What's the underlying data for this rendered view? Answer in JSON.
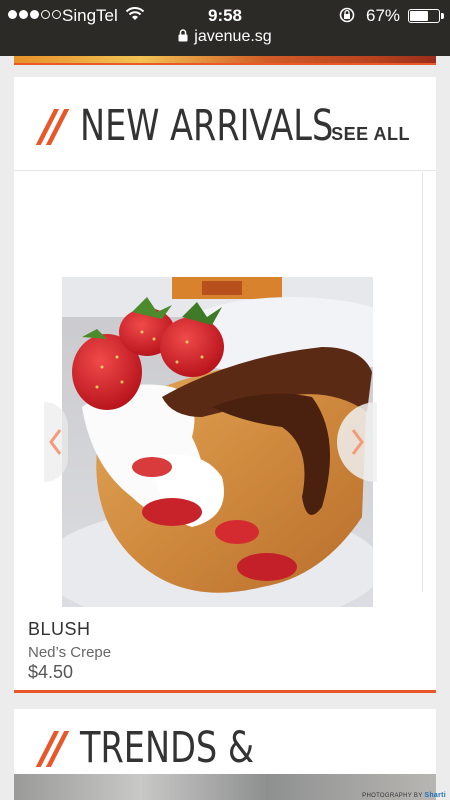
{
  "status_bar": {
    "carrier": "SingTel",
    "time": "9:58",
    "battery_percent": "67%",
    "battery_level": 0.67,
    "signal_bars": 3,
    "url": "javenue.sg"
  },
  "new_arrivals": {
    "slashes": "//",
    "title": "NEW ARRIVALS",
    "see_all": "SEE ALL",
    "product": {
      "name": "BLUSH",
      "shop": "Ned’s Crepe",
      "price": "$4.50"
    }
  },
  "trends": {
    "slashes": "//",
    "title": "TRENDS & FEATURES",
    "photo_credit_prefix": "PHOTOGRAPHY BY",
    "photo_credit_name": "Sharti"
  },
  "colors": {
    "accent": "#e8562a",
    "status_bar": "#2b2a26",
    "page_bg": "#ececec"
  }
}
